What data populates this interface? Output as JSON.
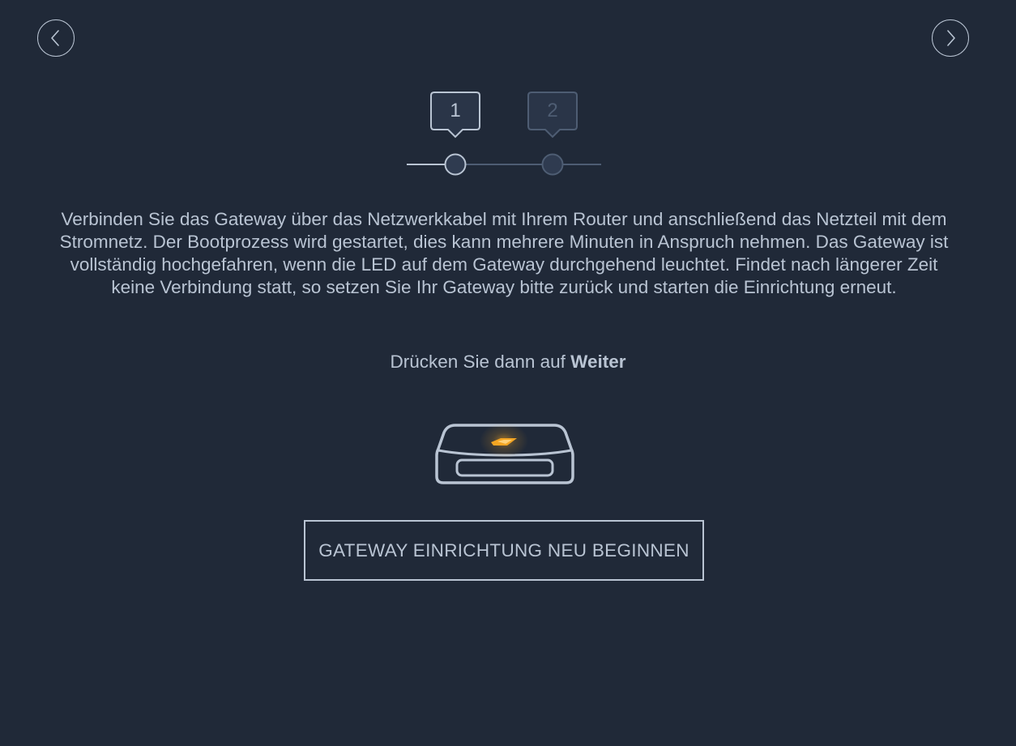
{
  "navigation": {
    "prev_icon": "chevron-left-icon",
    "next_icon": "chevron-right-icon"
  },
  "stepper": {
    "steps": [
      {
        "label": "1",
        "state": "active"
      },
      {
        "label": "2",
        "state": "inactive"
      }
    ],
    "active_color": "#b9c4d3",
    "inactive_color": "#4e5d73"
  },
  "instructions": {
    "text": "Verbinden Sie das Gateway über das Netzwerkkabel mit Ihrem Router und anschließend das Netzteil mit dem Stromnetz. Der Bootprozess wird gestartet, dies kann mehrere Minuten in Anspruch nehmen. Das Gateway ist vollständig hochgefahren, wenn die LED auf dem Gateway durchgehend leuchtet. Findet nach längerer Zeit keine Verbindung statt, so setzen Sie Ihr Gateway bitte zurück und starten die Einrichtung erneut.",
    "press_prefix": "Drücken Sie dann auf ",
    "press_emphasis": "Weiter"
  },
  "illustration": {
    "icon": "gateway-device-icon",
    "led_color": "#f5a623"
  },
  "restart_button": {
    "label": "GATEWAY EINRICHTUNG NEU BEGINNEN"
  },
  "colors": {
    "background": "#202938",
    "foreground": "#b9c4d3"
  }
}
